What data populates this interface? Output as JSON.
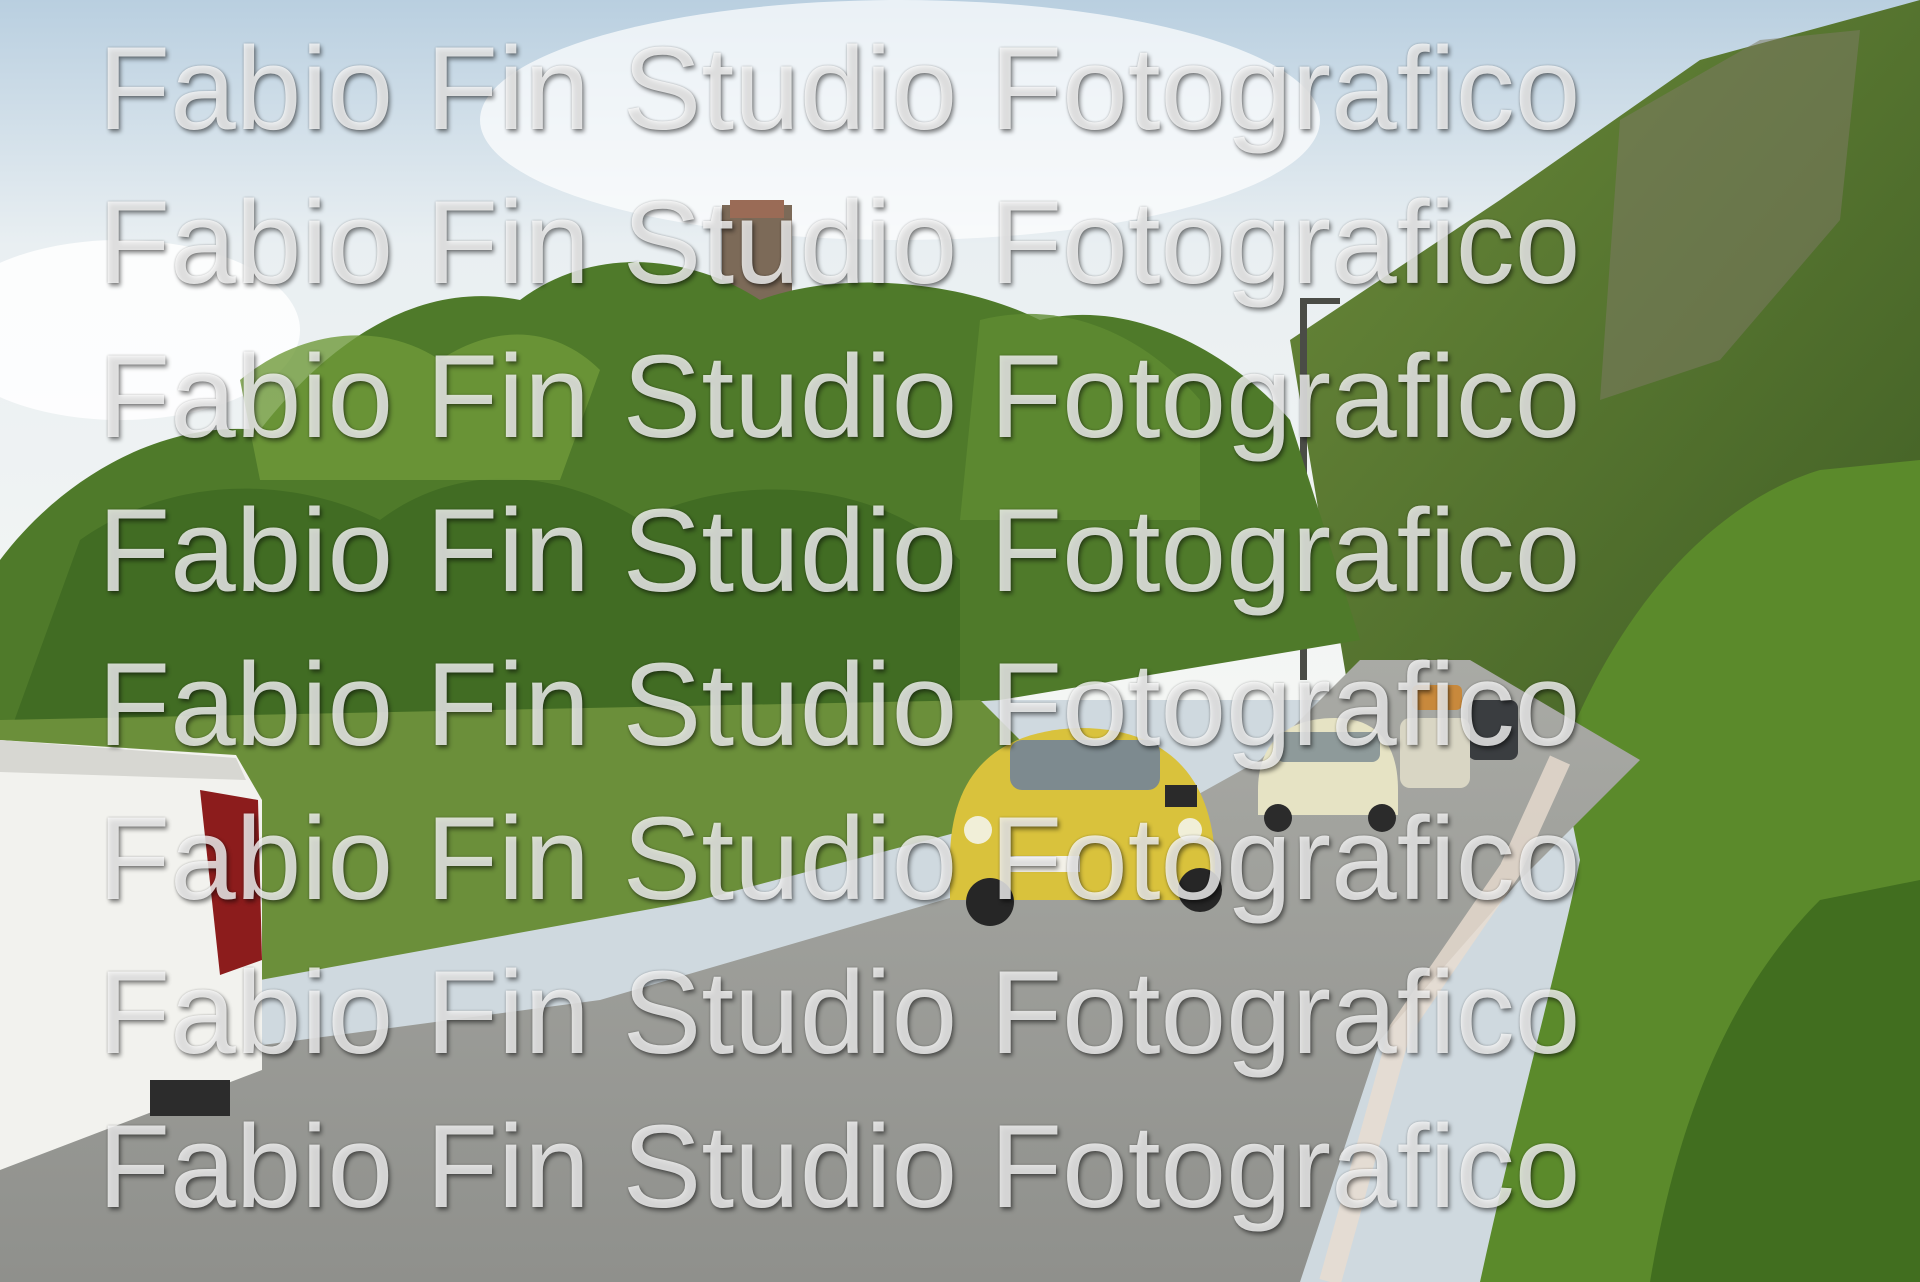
{
  "photo": {
    "subject": "vintage-car-parade-on-mountain-road",
    "colors": {
      "sky": "#dfe8ee",
      "foliage": "#4f7a2a",
      "road": "#9a9b97",
      "yellow_car": "#d9c23c",
      "cream_car": "#e6e3c4",
      "pickup": "#f2f2ee"
    }
  },
  "watermark": {
    "lines": [
      "Fabio Fin Studio Fotografico",
      "Fabio Fin Studio Fotografico",
      "Fabio Fin Studio Fotografico",
      "Fabio Fin Studio Fotografico",
      "Fabio Fin Studio Fotografico",
      "Fabio Fin Studio Fotografico",
      "Fabio Fin Studio Fotografico",
      "Fabio Fin Studio Fotografico"
    ]
  }
}
